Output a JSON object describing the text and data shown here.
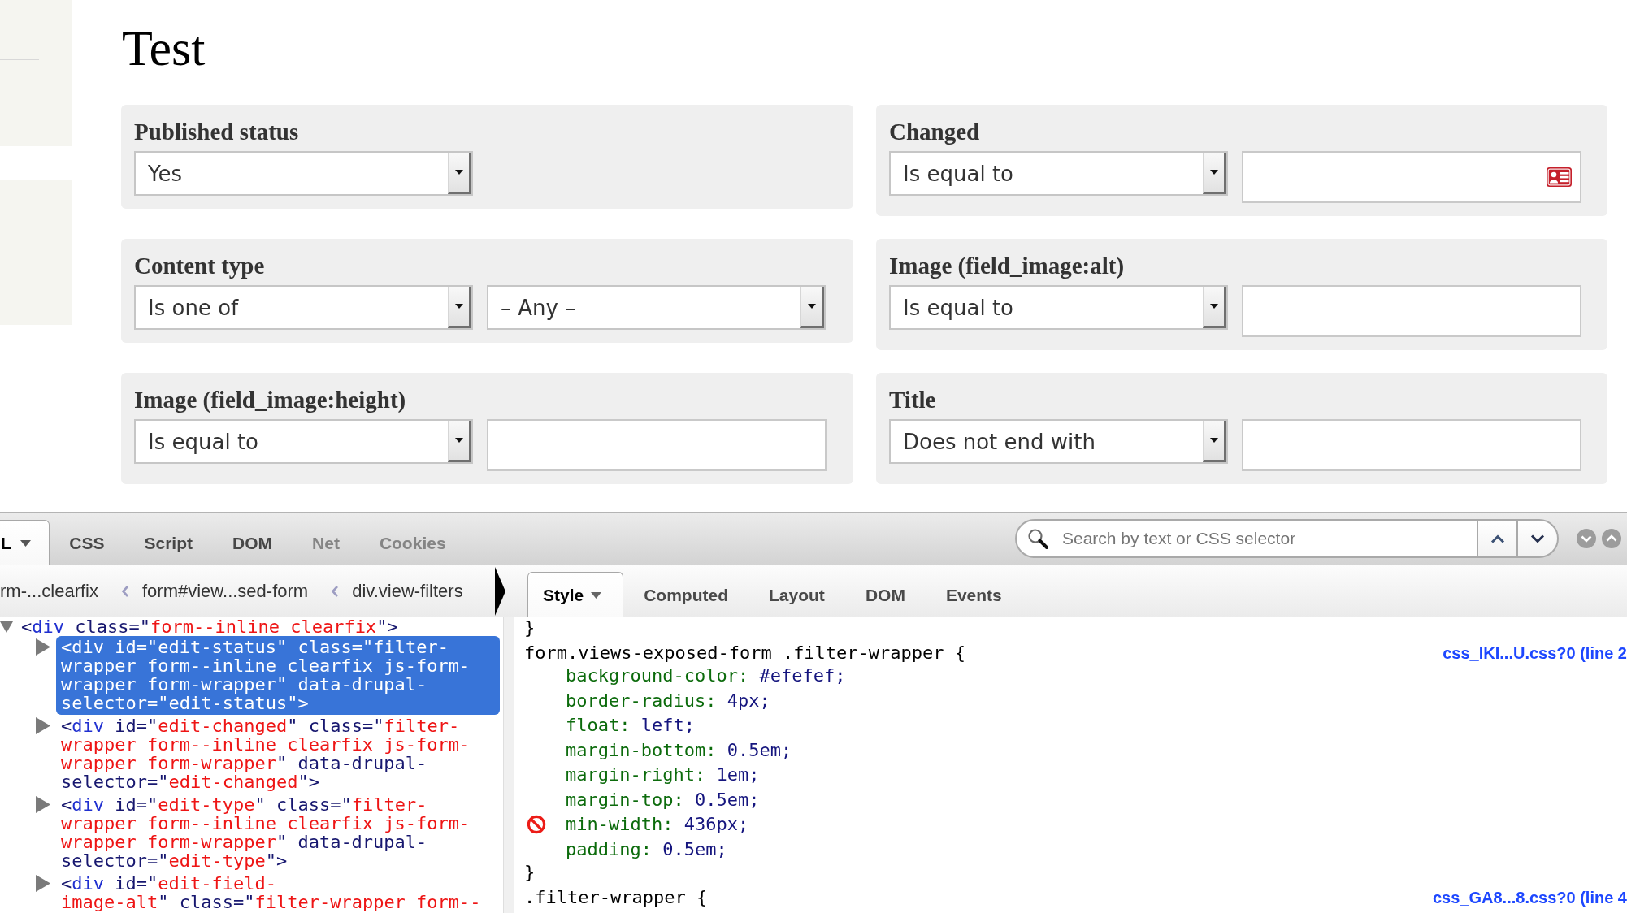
{
  "page": {
    "title": "Test",
    "filters": [
      {
        "label": "Published status",
        "controls": [
          {
            "kind": "select",
            "value": "Yes"
          }
        ]
      },
      {
        "label": "Changed",
        "controls": [
          {
            "kind": "select",
            "value": "Is equal to"
          },
          {
            "kind": "text",
            "card_icon": true
          }
        ]
      },
      {
        "label": "Content type",
        "controls": [
          {
            "kind": "select",
            "value": "Is one of"
          },
          {
            "kind": "select",
            "value": "– Any –"
          }
        ]
      },
      {
        "label": "Image (field_image:alt)",
        "controls": [
          {
            "kind": "select",
            "value": "Is equal to"
          },
          {
            "kind": "text",
            "card_icon": false
          }
        ]
      },
      {
        "label": "Image (field_image:height)",
        "controls": [
          {
            "kind": "select",
            "value": "Is equal to"
          },
          {
            "kind": "text",
            "card_icon": false
          }
        ]
      },
      {
        "label": "Title",
        "controls": [
          {
            "kind": "select",
            "value": "Does not end with"
          },
          {
            "kind": "text",
            "card_icon": false
          }
        ]
      }
    ]
  },
  "devtools": {
    "panel_tabs": [
      {
        "label": "L",
        "selected": true,
        "dropdown": true,
        "disabled": false
      },
      {
        "label": "CSS",
        "selected": false,
        "dropdown": false,
        "disabled": false
      },
      {
        "label": "Script",
        "selected": false,
        "dropdown": false,
        "disabled": false
      },
      {
        "label": "DOM",
        "selected": false,
        "dropdown": false,
        "disabled": false
      },
      {
        "label": "Net",
        "selected": false,
        "dropdown": false,
        "disabled": true
      },
      {
        "label": "Cookies",
        "selected": false,
        "dropdown": false,
        "disabled": true
      }
    ],
    "search": {
      "placeholder": "Search by text or CSS selector"
    },
    "breadcrumbs": [
      "rm-...clearfix",
      "form#view...sed-form",
      "div.view-filters"
    ],
    "side_tabs": [
      {
        "label": "Style",
        "selected": true,
        "dropdown": true
      },
      {
        "label": "Computed",
        "selected": false,
        "dropdown": false
      },
      {
        "label": "Layout",
        "selected": false,
        "dropdown": false
      },
      {
        "label": "DOM",
        "selected": false,
        "dropdown": false
      },
      {
        "label": "Events",
        "selected": false,
        "dropdown": false
      }
    ],
    "html_tree": [
      {
        "selected": false,
        "expanded": true,
        "lines": [
          [
            {
              "kind": "attr",
              "text": "<"
            },
            {
              "kind": "tag",
              "text": "div"
            },
            {
              "kind": "attr",
              "text": " class=\""
            },
            {
              "kind": "value",
              "text": "form--inline clearfix"
            },
            {
              "kind": "attr",
              "text": "\">"
            }
          ]
        ],
        "children": [
          {
            "selected": true,
            "expanded": false,
            "lines": [
              [
                {
                  "kind": "attr",
                  "text": "<"
                },
                {
                  "kind": "tag",
                  "text": "div"
                },
                {
                  "kind": "attr",
                  "text": " id=\""
                },
                {
                  "kind": "value",
                  "text": "edit-status"
                },
                {
                  "kind": "attr",
                  "text": "\" class=\""
                },
                {
                  "kind": "value",
                  "text": "filter-"
                }
              ],
              [
                {
                  "kind": "value",
                  "text": "wrapper form--inline clearfix js-form-"
                }
              ],
              [
                {
                  "kind": "value",
                  "text": "wrapper form-wrapper"
                },
                {
                  "kind": "attr",
                  "text": "\" data-drupal-"
                }
              ],
              [
                {
                  "kind": "attr",
                  "text": "selector=\""
                },
                {
                  "kind": "value",
                  "text": "edit-status"
                },
                {
                  "kind": "attr",
                  "text": "\">"
                }
              ]
            ]
          },
          {
            "selected": false,
            "expanded": false,
            "lines": [
              [
                {
                  "kind": "attr",
                  "text": "<"
                },
                {
                  "kind": "tag",
                  "text": "div"
                },
                {
                  "kind": "attr",
                  "text": " id=\""
                },
                {
                  "kind": "value",
                  "text": "edit-changed"
                },
                {
                  "kind": "attr",
                  "text": "\" class=\""
                },
                {
                  "kind": "value",
                  "text": "filter-"
                }
              ],
              [
                {
                  "kind": "value",
                  "text": "wrapper form--inline clearfix js-form-"
                }
              ],
              [
                {
                  "kind": "value",
                  "text": "wrapper form-wrapper"
                },
                {
                  "kind": "attr",
                  "text": "\" data-drupal-"
                }
              ],
              [
                {
                  "kind": "attr",
                  "text": "selector=\""
                },
                {
                  "kind": "value",
                  "text": "edit-changed"
                },
                {
                  "kind": "attr",
                  "text": "\">"
                }
              ]
            ]
          },
          {
            "selected": false,
            "expanded": false,
            "lines": [
              [
                {
                  "kind": "attr",
                  "text": "<"
                },
                {
                  "kind": "tag",
                  "text": "div"
                },
                {
                  "kind": "attr",
                  "text": " id=\""
                },
                {
                  "kind": "value",
                  "text": "edit-type"
                },
                {
                  "kind": "attr",
                  "text": "\" class=\""
                },
                {
                  "kind": "value",
                  "text": "filter-"
                }
              ],
              [
                {
                  "kind": "value",
                  "text": "wrapper form--inline clearfix js-form-"
                }
              ],
              [
                {
                  "kind": "value",
                  "text": "wrapper form-wrapper"
                },
                {
                  "kind": "attr",
                  "text": "\" data-drupal-"
                }
              ],
              [
                {
                  "kind": "attr",
                  "text": "selector=\""
                },
                {
                  "kind": "value",
                  "text": "edit-type"
                },
                {
                  "kind": "attr",
                  "text": "\">"
                }
              ]
            ]
          },
          {
            "selected": false,
            "expanded": false,
            "lines": [
              [
                {
                  "kind": "attr",
                  "text": "<"
                },
                {
                  "kind": "tag",
                  "text": "div"
                },
                {
                  "kind": "attr",
                  "text": " id=\""
                },
                {
                  "kind": "value",
                  "text": "edit-field-"
                }
              ],
              [
                {
                  "kind": "value",
                  "text": "image-alt"
                },
                {
                  "kind": "attr",
                  "text": "\" class=\""
                },
                {
                  "kind": "value",
                  "text": "filter-wrapper form--"
                }
              ]
            ]
          }
        ]
      }
    ],
    "style_rules": [
      {
        "close": "}"
      },
      {
        "selector": "form.views-exposed-form .filter-wrapper {",
        "source": "css_IKI...U.css?0 (line 2",
        "properties": [
          {
            "name": "background-color:",
            "value": "#efefef;",
            "disabled": false
          },
          {
            "name": "border-radius:",
            "value": "4px;",
            "disabled": false
          },
          {
            "name": "float:",
            "value": "left;",
            "disabled": false
          },
          {
            "name": "margin-bottom:",
            "value": "0.5em;",
            "disabled": false
          },
          {
            "name": "margin-right:",
            "value": "1em;",
            "disabled": false
          },
          {
            "name": "margin-top:",
            "value": "0.5em;",
            "disabled": false
          },
          {
            "name": "min-width:",
            "value": "436px;",
            "disabled": true
          },
          {
            "name": "padding:",
            "value": "0.5em;",
            "disabled": false
          }
        ],
        "close": "}"
      },
      {
        "selector": ".filter-wrapper {",
        "source": "css_GA8...8.css?0 (line 4"
      }
    ]
  }
}
